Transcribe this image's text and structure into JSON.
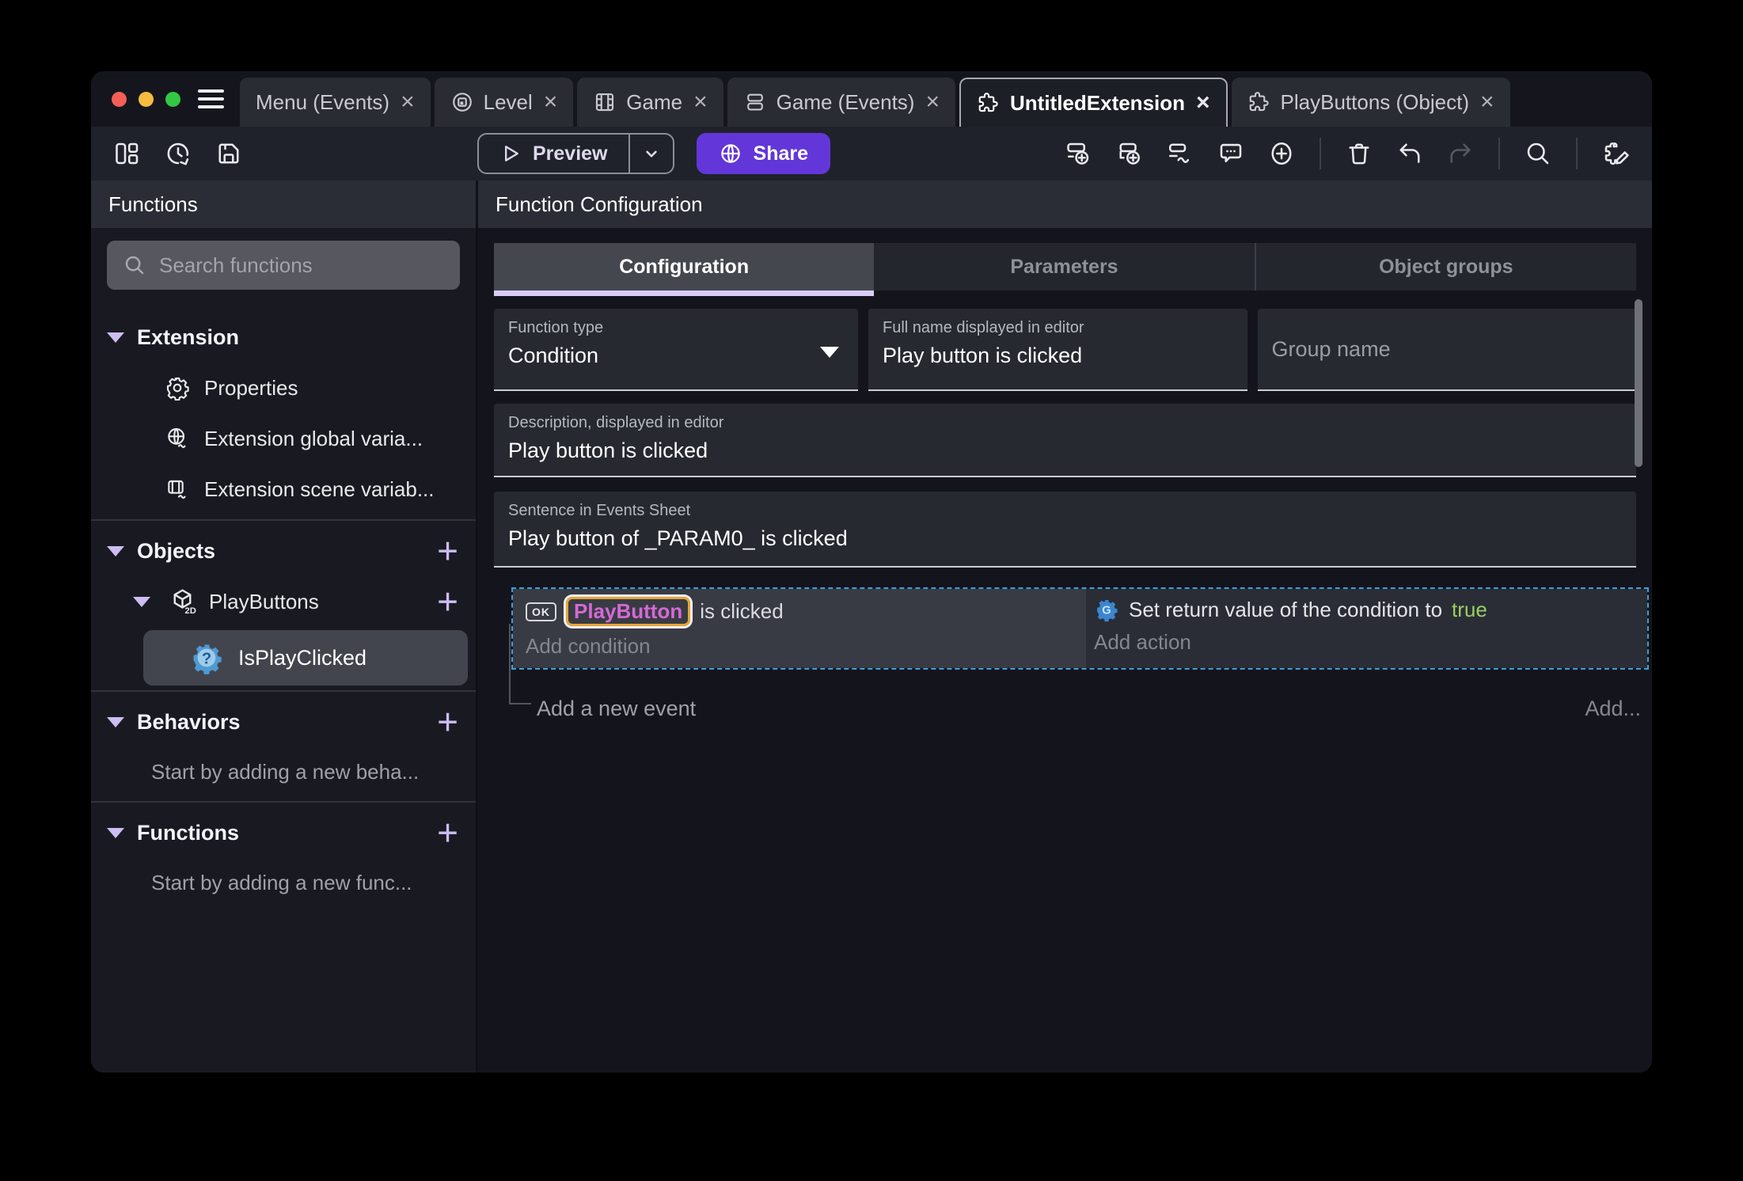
{
  "titlebar": {
    "tabs": [
      {
        "label": "Menu (Events)"
      },
      {
        "label": "Level"
      },
      {
        "label": "Game"
      },
      {
        "label": "Game (Events)"
      },
      {
        "label": "UntitledExtension"
      },
      {
        "label": "PlayButtons (Object)"
      }
    ]
  },
  "toolbar": {
    "preview_label": "Preview",
    "share_label": "Share"
  },
  "sidebar": {
    "title": "Functions",
    "search_placeholder": "Search functions",
    "extension_section": {
      "label": "Extension",
      "items": [
        {
          "label": "Properties"
        },
        {
          "label": "Extension global varia..."
        },
        {
          "label": "Extension scene variab..."
        }
      ]
    },
    "objects_section": {
      "label": "Objects",
      "object_label": "PlayButtons",
      "function_label": "IsPlayClicked"
    },
    "behaviors_section": {
      "label": "Behaviors",
      "hint": "Start by adding a new beha..."
    },
    "functions_section": {
      "label": "Functions",
      "hint": "Start by adding a new func..."
    }
  },
  "main": {
    "title": "Function Configuration",
    "tabs": [
      {
        "label": "Configuration"
      },
      {
        "label": "Parameters"
      },
      {
        "label": "Object groups"
      }
    ],
    "form": {
      "function_type_label": "Function type",
      "function_type_value": "Condition",
      "full_name_label": "Full name displayed in editor",
      "full_name_value": "Play button is clicked",
      "group_name_placeholder": "Group name",
      "description_label": "Description, displayed in editor",
      "description_value": "Play button is clicked",
      "sentence_label": "Sentence in Events Sheet",
      "sentence_value": "Play button of _PARAM0_ is clicked"
    },
    "events": {
      "condition_object": "PlayButton",
      "condition_text": "is clicked",
      "add_condition": "Add condition",
      "action_text": "Set return value of the condition to",
      "action_value": "true",
      "add_action": "Add action",
      "add_event": "Add a new event",
      "add_more": "Add..."
    }
  },
  "glyphs": {
    "close": "×",
    "plus": "+",
    "ok": "OK",
    "badge_2d": "2D",
    "question": "?",
    "g": "G"
  },
  "colors": {
    "accent_purple": "#6336d9",
    "lavender_accent": "#cdbdf2",
    "tab_underline": "#d9cdf8",
    "selection_blue": "#3f9fd9",
    "object_chip_pink": "#d569d5",
    "object_chip_border": "#e5a43a",
    "boolean_green": "#9ccf62",
    "traffic_red": "#f35f57",
    "traffic_yellow": "#f6bc3e",
    "traffic_green": "#32c745"
  }
}
